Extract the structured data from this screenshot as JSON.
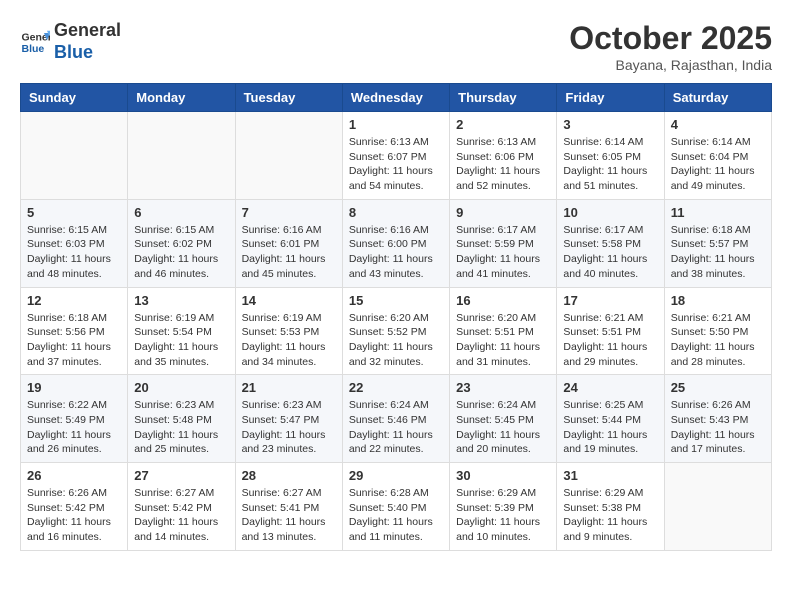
{
  "header": {
    "logo_line1": "General",
    "logo_line2": "Blue",
    "month": "October 2025",
    "location": "Bayana, Rajasthan, India"
  },
  "weekdays": [
    "Sunday",
    "Monday",
    "Tuesday",
    "Wednesday",
    "Thursday",
    "Friday",
    "Saturday"
  ],
  "weeks": [
    [
      {
        "day": "",
        "info": ""
      },
      {
        "day": "",
        "info": ""
      },
      {
        "day": "",
        "info": ""
      },
      {
        "day": "1",
        "info": "Sunrise: 6:13 AM\nSunset: 6:07 PM\nDaylight: 11 hours\nand 54 minutes."
      },
      {
        "day": "2",
        "info": "Sunrise: 6:13 AM\nSunset: 6:06 PM\nDaylight: 11 hours\nand 52 minutes."
      },
      {
        "day": "3",
        "info": "Sunrise: 6:14 AM\nSunset: 6:05 PM\nDaylight: 11 hours\nand 51 minutes."
      },
      {
        "day": "4",
        "info": "Sunrise: 6:14 AM\nSunset: 6:04 PM\nDaylight: 11 hours\nand 49 minutes."
      }
    ],
    [
      {
        "day": "5",
        "info": "Sunrise: 6:15 AM\nSunset: 6:03 PM\nDaylight: 11 hours\nand 48 minutes."
      },
      {
        "day": "6",
        "info": "Sunrise: 6:15 AM\nSunset: 6:02 PM\nDaylight: 11 hours\nand 46 minutes."
      },
      {
        "day": "7",
        "info": "Sunrise: 6:16 AM\nSunset: 6:01 PM\nDaylight: 11 hours\nand 45 minutes."
      },
      {
        "day": "8",
        "info": "Sunrise: 6:16 AM\nSunset: 6:00 PM\nDaylight: 11 hours\nand 43 minutes."
      },
      {
        "day": "9",
        "info": "Sunrise: 6:17 AM\nSunset: 5:59 PM\nDaylight: 11 hours\nand 41 minutes."
      },
      {
        "day": "10",
        "info": "Sunrise: 6:17 AM\nSunset: 5:58 PM\nDaylight: 11 hours\nand 40 minutes."
      },
      {
        "day": "11",
        "info": "Sunrise: 6:18 AM\nSunset: 5:57 PM\nDaylight: 11 hours\nand 38 minutes."
      }
    ],
    [
      {
        "day": "12",
        "info": "Sunrise: 6:18 AM\nSunset: 5:56 PM\nDaylight: 11 hours\nand 37 minutes."
      },
      {
        "day": "13",
        "info": "Sunrise: 6:19 AM\nSunset: 5:54 PM\nDaylight: 11 hours\nand 35 minutes."
      },
      {
        "day": "14",
        "info": "Sunrise: 6:19 AM\nSunset: 5:53 PM\nDaylight: 11 hours\nand 34 minutes."
      },
      {
        "day": "15",
        "info": "Sunrise: 6:20 AM\nSunset: 5:52 PM\nDaylight: 11 hours\nand 32 minutes."
      },
      {
        "day": "16",
        "info": "Sunrise: 6:20 AM\nSunset: 5:51 PM\nDaylight: 11 hours\nand 31 minutes."
      },
      {
        "day": "17",
        "info": "Sunrise: 6:21 AM\nSunset: 5:51 PM\nDaylight: 11 hours\nand 29 minutes."
      },
      {
        "day": "18",
        "info": "Sunrise: 6:21 AM\nSunset: 5:50 PM\nDaylight: 11 hours\nand 28 minutes."
      }
    ],
    [
      {
        "day": "19",
        "info": "Sunrise: 6:22 AM\nSunset: 5:49 PM\nDaylight: 11 hours\nand 26 minutes."
      },
      {
        "day": "20",
        "info": "Sunrise: 6:23 AM\nSunset: 5:48 PM\nDaylight: 11 hours\nand 25 minutes."
      },
      {
        "day": "21",
        "info": "Sunrise: 6:23 AM\nSunset: 5:47 PM\nDaylight: 11 hours\nand 23 minutes."
      },
      {
        "day": "22",
        "info": "Sunrise: 6:24 AM\nSunset: 5:46 PM\nDaylight: 11 hours\nand 22 minutes."
      },
      {
        "day": "23",
        "info": "Sunrise: 6:24 AM\nSunset: 5:45 PM\nDaylight: 11 hours\nand 20 minutes."
      },
      {
        "day": "24",
        "info": "Sunrise: 6:25 AM\nSunset: 5:44 PM\nDaylight: 11 hours\nand 19 minutes."
      },
      {
        "day": "25",
        "info": "Sunrise: 6:26 AM\nSunset: 5:43 PM\nDaylight: 11 hours\nand 17 minutes."
      }
    ],
    [
      {
        "day": "26",
        "info": "Sunrise: 6:26 AM\nSunset: 5:42 PM\nDaylight: 11 hours\nand 16 minutes."
      },
      {
        "day": "27",
        "info": "Sunrise: 6:27 AM\nSunset: 5:42 PM\nDaylight: 11 hours\nand 14 minutes."
      },
      {
        "day": "28",
        "info": "Sunrise: 6:27 AM\nSunset: 5:41 PM\nDaylight: 11 hours\nand 13 minutes."
      },
      {
        "day": "29",
        "info": "Sunrise: 6:28 AM\nSunset: 5:40 PM\nDaylight: 11 hours\nand 11 minutes."
      },
      {
        "day": "30",
        "info": "Sunrise: 6:29 AM\nSunset: 5:39 PM\nDaylight: 11 hours\nand 10 minutes."
      },
      {
        "day": "31",
        "info": "Sunrise: 6:29 AM\nSunset: 5:38 PM\nDaylight: 11 hours\nand 9 minutes."
      },
      {
        "day": "",
        "info": ""
      }
    ]
  ]
}
